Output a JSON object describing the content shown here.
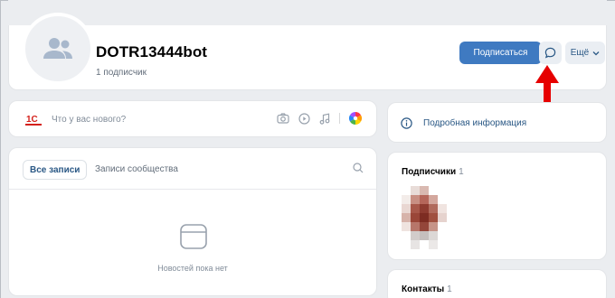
{
  "profile": {
    "username": "DOTR13444bot",
    "subscribers": "1 подписчик",
    "subscribe_label": "Подписаться",
    "more_label": "Ещё"
  },
  "newpost": {
    "logo_text": "1С",
    "placeholder": "Что у вас нового?"
  },
  "info": {
    "label": "Подробная информация"
  },
  "feed": {
    "tab_all": "Все записи",
    "tab_community": "Записи сообщества",
    "empty_text": "Новостей пока нет"
  },
  "followers": {
    "title": "Подписчики",
    "count": "1"
  },
  "contacts": {
    "title": "Контакты",
    "count": "1"
  },
  "colors": {
    "accent": "#3f7ac1",
    "link": "#2a5885",
    "background": "#ebedf0",
    "arrow": "#e60000"
  },
  "icons": [
    "users-icon",
    "message-icon",
    "chevron-down-icon",
    "camera-icon",
    "video-icon",
    "music-icon",
    "color-wheel-icon",
    "info-icon",
    "search-icon",
    "empty-feed-icon"
  ]
}
